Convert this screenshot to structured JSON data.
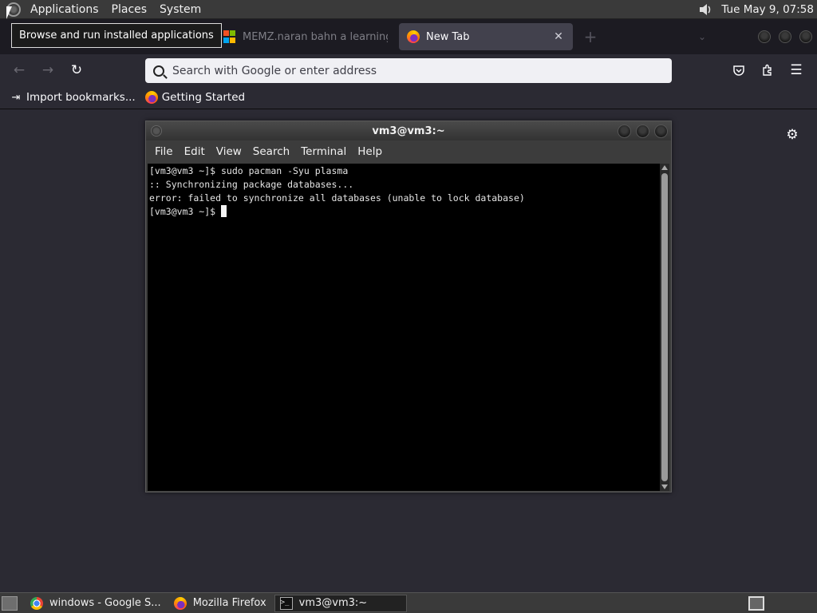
{
  "top_panel": {
    "menus": [
      "Applications",
      "Places",
      "System"
    ],
    "clock": "Tue May  9, 07:58"
  },
  "tooltip": "Browse and run installed applications",
  "browser": {
    "tabs": [
      {
        "title": "MEMZ.naran bahn a learning.v",
        "active": false
      },
      {
        "title": "New Tab",
        "active": true
      }
    ],
    "new_tab_symbol": "+",
    "url_placeholder": "Search with Google or enter address",
    "bookmarks": [
      {
        "label": "Import bookmarks..."
      },
      {
        "label": "Getting Started"
      }
    ]
  },
  "terminal": {
    "title": "vm3@vm3:~",
    "menus": [
      "File",
      "Edit",
      "View",
      "Search",
      "Terminal",
      "Help"
    ],
    "lines": [
      "[vm3@vm3 ~]$ sudo pacman -Syu plasma",
      ":: Synchronizing package databases...",
      "error: failed to synchronize all databases (unable to lock database)",
      "[vm3@vm3 ~]$ "
    ]
  },
  "taskbar": {
    "tasks": [
      {
        "label": "windows - Google S...",
        "icon": "chrome-icon"
      },
      {
        "label": "Mozilla Firefox",
        "icon": "firefox-icon"
      },
      {
        "label": "vm3@vm3:~",
        "icon": "terminal-icon",
        "active": true
      }
    ]
  },
  "colors": {
    "browser_bg": "#2b2a33",
    "tabbar_bg": "#1c1b22",
    "terminal_bg": "#000000",
    "panel_bg": "#3a3a3a"
  }
}
